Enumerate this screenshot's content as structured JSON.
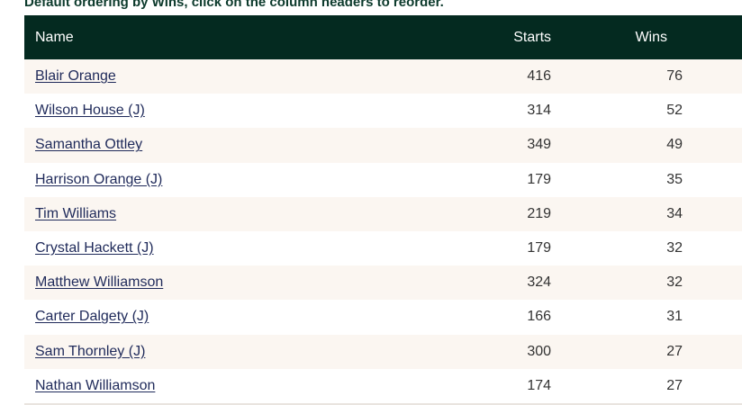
{
  "caption": "Default ordering by Wins, click on the column headers to reorder.",
  "columns": {
    "name": "Name",
    "starts": "Starts",
    "wins": "Wins"
  },
  "rows": [
    {
      "name": "Blair Orange",
      "starts": "416",
      "wins": "76"
    },
    {
      "name": "Wilson House (J)",
      "starts": "314",
      "wins": "52"
    },
    {
      "name": "Samantha Ottley",
      "starts": "349",
      "wins": "49"
    },
    {
      "name": "Harrison Orange (J)",
      "starts": "179",
      "wins": "35"
    },
    {
      "name": "Tim Williams",
      "starts": "219",
      "wins": "34"
    },
    {
      "name": "Crystal Hackett (J)",
      "starts": "179",
      "wins": "32"
    },
    {
      "name": "Matthew Williamson",
      "starts": "324",
      "wins": "32"
    },
    {
      "name": "Carter Dalgety (J)",
      "starts": "166",
      "wins": "31"
    },
    {
      "name": "Sam Thornley (J)",
      "starts": "300",
      "wins": "27"
    },
    {
      "name": "Nathan Williamson",
      "starts": "174",
      "wins": "27"
    }
  ],
  "colors": {
    "header_bg": "#042a20",
    "caption": "#0c3a2c",
    "stripe": "#fbf6f1",
    "link": "#1f2a5a"
  }
}
